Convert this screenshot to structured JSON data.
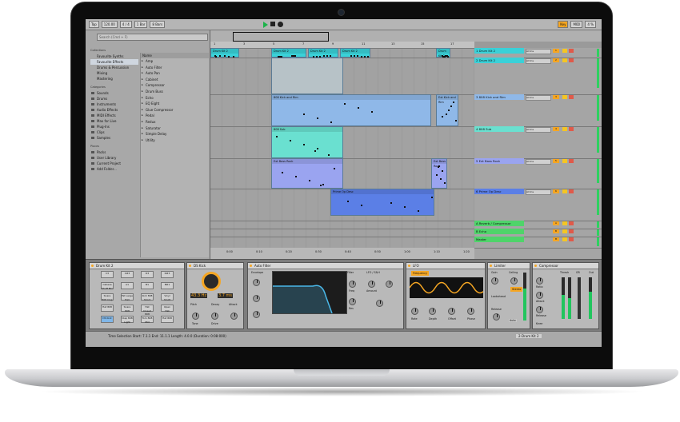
{
  "topbar": {
    "link": "Tap",
    "tempo": "120.00",
    "meter": "4 / 4",
    "quant": "1 Bar",
    "bars": "8 Bars",
    "key": "Key",
    "midi": "MIDI",
    "cpu": "4 %"
  },
  "browser": {
    "search_placeholder": "Search (Cmd + F)",
    "collections_header": "Collections",
    "collections": [
      {
        "label": "Favourite Synths",
        "color": "#f5a623"
      },
      {
        "label": "Favourite Effects",
        "color": "#f5c623",
        "selected": true
      },
      {
        "label": "Drums & Percussion",
        "color": "#8bc34a"
      },
      {
        "label": "Mixing",
        "color": "#7fb6e8"
      },
      {
        "label": "Mastering",
        "color": "#b58ed6"
      }
    ],
    "categories_header": "Categories",
    "categories": [
      "Sounds",
      "Drums",
      "Instruments",
      "Audio Effects",
      "MIDI Effects",
      "Max for Live",
      "Plug-Ins",
      "Clips",
      "Samples"
    ],
    "places_header": "Places",
    "places": [
      "Packs",
      "User Library",
      "Current Project",
      "Add Folder..."
    ],
    "files_header": "Name",
    "files": [
      "Amp",
      "Auto Filter",
      "Auto Pan",
      "Cabinet",
      "Compressor",
      "Drum Buss",
      "Echo",
      "EQ Eight",
      "Glue Compressor",
      "Pedal",
      "Redux",
      "Saturator",
      "Simple Delay",
      "Utility"
    ]
  },
  "arrangement": {
    "ruler": [
      "1",
      "3",
      "5",
      "7",
      "9",
      "11",
      "13",
      "15",
      "17"
    ],
    "time_marks": [
      "0:00",
      "0:10",
      "0:20",
      "0:30",
      "0:40",
      "0:50",
      "1:00",
      "1:10",
      "1:20"
    ],
    "clips": [
      {
        "label": "Drum Kit 2",
        "color": "#3ad1d8"
      },
      {
        "label": "Drum Kit 2",
        "color": "#3ad1d8"
      },
      {
        "label": "Drum Kit 2",
        "color": "#3ad1d8"
      },
      {
        "label": "Drum Kit 2",
        "color": "#3ad1d8"
      },
      {
        "label": "Drum Kit 2",
        "color": "#3ad1d8"
      },
      {
        "label": "808 Kick and Rim",
        "color": "#8fb8e8"
      },
      {
        "label": "Ext Kick and Rim",
        "color": "#8fb8e8"
      },
      {
        "label": "808 Sub",
        "color": "#6ae0d0"
      },
      {
        "label": "Ext Bass Rock",
        "color": "#9aa4f0"
      },
      {
        "label": "Ext Bass Rock",
        "color": "#9aa4f0"
      },
      {
        "label": "Prime Op Desc",
        "color": "#5b7fe6"
      }
    ]
  },
  "tracks": [
    {
      "name": "1 Drum Kit 2",
      "color": "#3ad1d8",
      "input": "All Ins",
      "num": "1"
    },
    {
      "name": "2 Drum Kit 2",
      "color": "#3ad1d8",
      "input": "All Ins",
      "num": "2"
    },
    {
      "name": "3 808 Kick and Rim",
      "color": "#8fb8e8",
      "input": "All Ins",
      "num": "3"
    },
    {
      "name": "4 808 Sub",
      "color": "#6ae0d0",
      "input": "All Ins",
      "num": "4"
    },
    {
      "name": "5 Ext Bass Rock",
      "color": "#9aa4f0",
      "input": "All Ins",
      "num": "5"
    },
    {
      "name": "6 Prime Op Desc",
      "color": "#5b7fe6",
      "input": "All Ins",
      "num": "6"
    },
    {
      "name": "A Reverb / Compressor",
      "color": "#4fd46a",
      "input": "",
      "num": "A"
    },
    {
      "name": "B Echo",
      "color": "#4fd46a",
      "input": "",
      "num": "B"
    },
    {
      "name": "Master",
      "color": "#4fd46a",
      "input": "",
      "num": "M"
    }
  ],
  "devices": {
    "drumkit": {
      "title": "Drum Kit 2",
      "pads": [
        "C3",
        "C#3",
        "D3",
        "D#3",
        "Cabasa Shuff Mix",
        "A1",
        "B1",
        "B#1",
        "Snare 808 Clap",
        "Fat Large Hall",
        "Kick 808 Short",
        "Vinyl Shutt",
        "Hat 808",
        "Snare 808",
        "Hat Closed 808",
        "Open Hat",
        "DS Kick",
        "Clap 808 Light",
        "Tom 808 Mid",
        "Hat 808"
      ]
    },
    "dskick": {
      "title": "DS Kick",
      "labels": [
        "Pitch",
        "Decay",
        "Attack",
        "Tone",
        "Drive"
      ],
      "value_left": "43.3 Hz",
      "value_right": "3.7 ms"
    },
    "autofilter": {
      "title": "Auto Filter",
      "envelope": "Envelope",
      "filter": "Filter",
      "lfo": "LFO / S&H",
      "freq": "Freq",
      "res": "Res",
      "amount": "Amount"
    },
    "lfo": {
      "title": "LFO",
      "mode": "Frequency",
      "rate": "Rate",
      "depth": "Depth",
      "offset": "Offset",
      "phase": "Phase"
    },
    "limiter": {
      "title": "Limiter",
      "gain": "Gain",
      "ceiling": "Ceiling",
      "stereo": "Stereo",
      "lookahead": "Lookahead",
      "release": "Release",
      "auto": "Auto"
    },
    "compressor": {
      "title": "Compressor",
      "thresh": "Thresh",
      "gr": "GR",
      "out": "Out",
      "ratio": "Ratio",
      "attack": "Attack",
      "release": "Release",
      "knee": "Knee"
    }
  },
  "statusbar": {
    "text": "Time Selection Start: 7.1.1 End: 11.1.1 Length: 4.0.0 (Duration: 0:08:000)",
    "track": "2-Drum Kit 2"
  }
}
